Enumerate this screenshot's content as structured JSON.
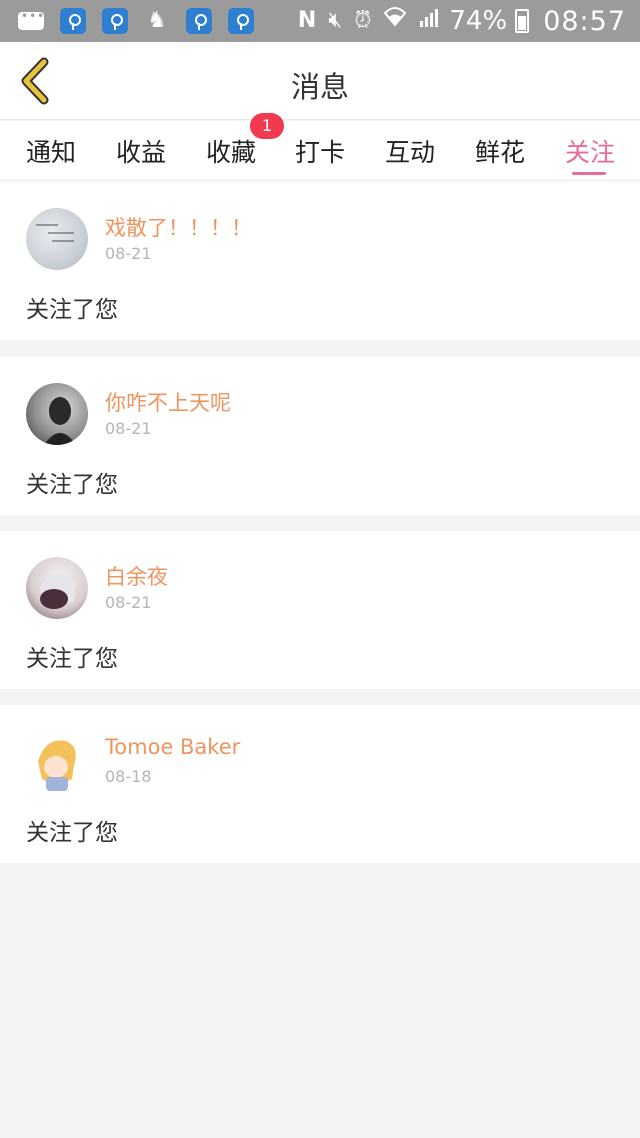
{
  "status_bar": {
    "battery": "74%",
    "time": "08:57",
    "left_icons": [
      "message-icon",
      "wifi-app-icon",
      "wifi-app-icon",
      "person-icon",
      "wifi-app-icon",
      "wifi-app-icon"
    ],
    "right_icons": [
      "nfc-icon",
      "mute-icon",
      "alarm-icon",
      "wifi-icon",
      "signal-icon",
      "battery-icon"
    ]
  },
  "header": {
    "title": "消息",
    "back_icon": "chevron-left-icon"
  },
  "tabs": [
    {
      "label": "通知"
    },
    {
      "label": "收益"
    },
    {
      "label": "收藏",
      "badge": "1"
    },
    {
      "label": "打卡"
    },
    {
      "label": "互动"
    },
    {
      "label": "鲜花"
    },
    {
      "label": "关注",
      "active": true
    }
  ],
  "follows": [
    {
      "name": "戏散了！！！！",
      "date": "08-21",
      "text": "关注了您"
    },
    {
      "name": "你咋不上天呢",
      "date": "08-21",
      "text": "关注了您"
    },
    {
      "name": "白余夜",
      "date": "08-21",
      "text": "关注了您"
    },
    {
      "name": "Tomoe Baker",
      "date": "08-18",
      "text": "关注了您"
    }
  ],
  "colors": {
    "accent": "#e86b9a",
    "username": "#f0945e",
    "badge": "#f03a50",
    "back_chevron": "#e8c23a",
    "background": "#f4f4f4"
  }
}
